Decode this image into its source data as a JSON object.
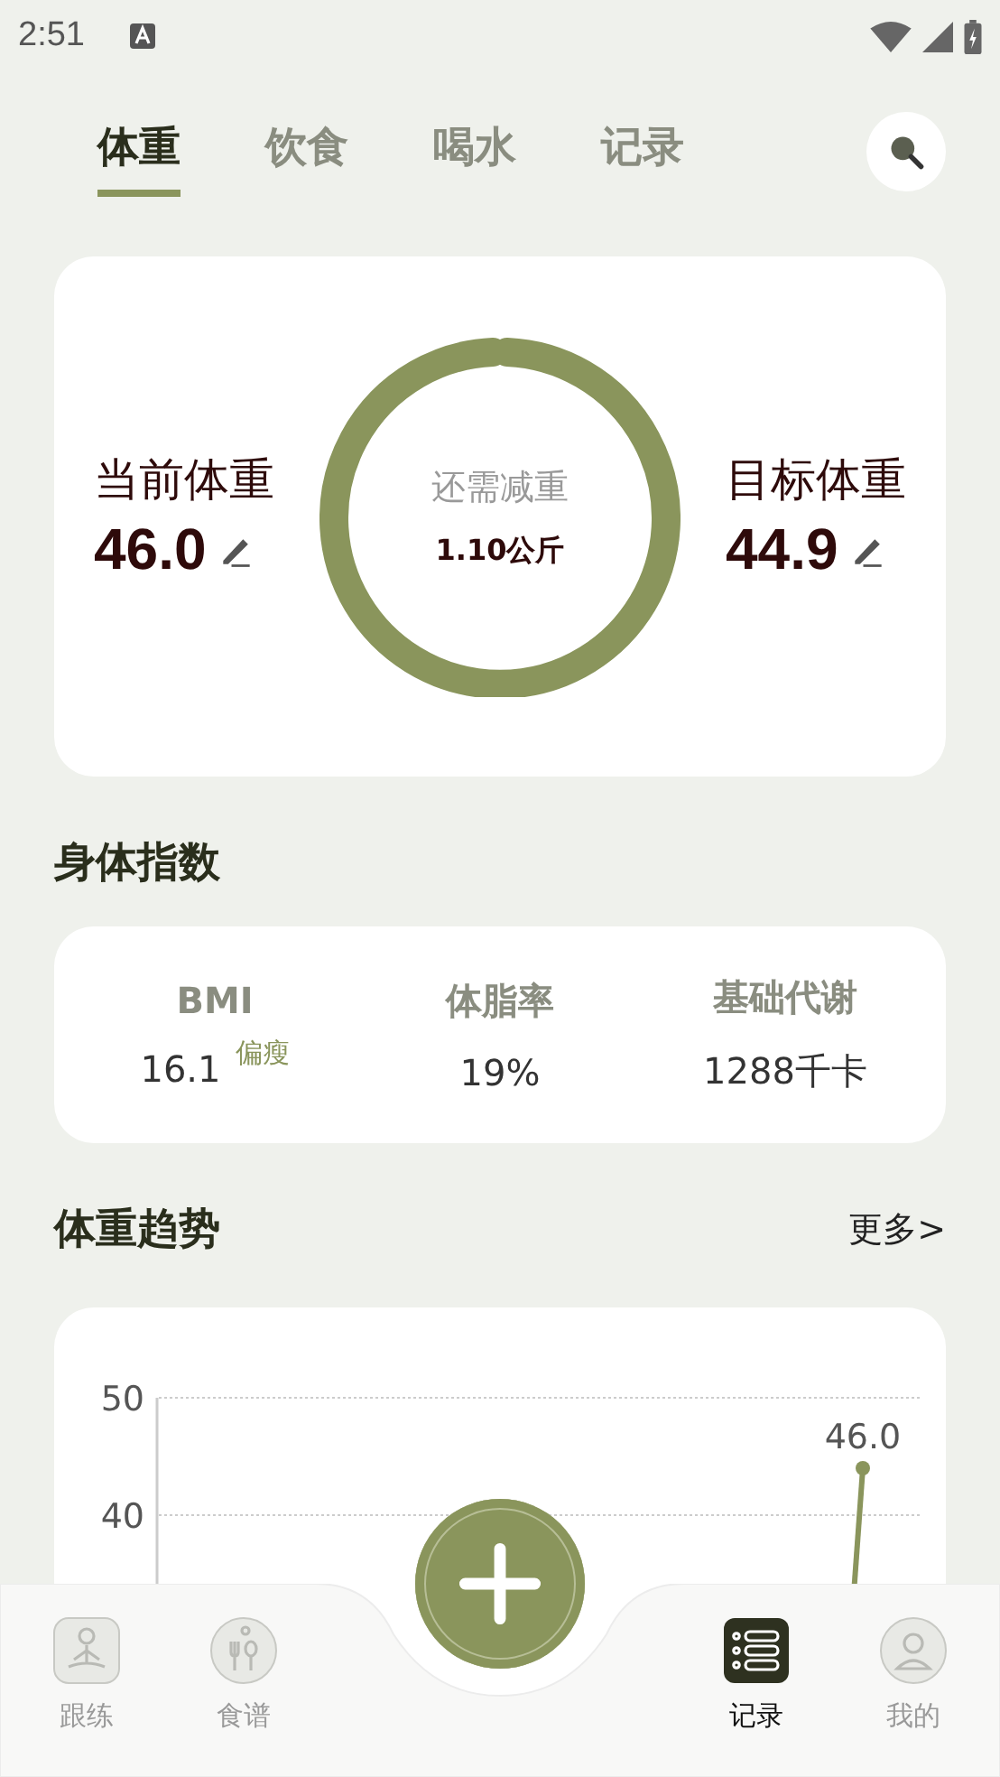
{
  "status_bar": {
    "time": "2:51"
  },
  "tabs": [
    {
      "label": "体重",
      "selected": true
    },
    {
      "label": "饮食",
      "selected": false
    },
    {
      "label": "喝水",
      "selected": false
    },
    {
      "label": "记录",
      "selected": false
    }
  ],
  "weight_card": {
    "current_label": "当前体重",
    "current_value": "46.0",
    "remaining_label": "还需减重",
    "remaining_value": "1.10公斤",
    "target_label": "目标体重",
    "target_value": "44.9"
  },
  "body_index": {
    "title": "身体指数",
    "items": [
      {
        "label": "BMI",
        "value": "16.1",
        "badge": "偏瘦"
      },
      {
        "label": "体脂率",
        "value": "19%"
      },
      {
        "label": "基础代谢",
        "value": "1288千卡"
      }
    ]
  },
  "trend": {
    "title": "体重趋势",
    "more": "更多>",
    "chart": {
      "y_axis_labels": [
        "50",
        "40"
      ],
      "point_label": "46.0"
    }
  },
  "bottom_nav": [
    {
      "label": "跟练",
      "selected": false
    },
    {
      "label": "食谱",
      "selected": false
    },
    {
      "label": "记录",
      "selected": true
    },
    {
      "label": "我的",
      "selected": false
    }
  ]
}
